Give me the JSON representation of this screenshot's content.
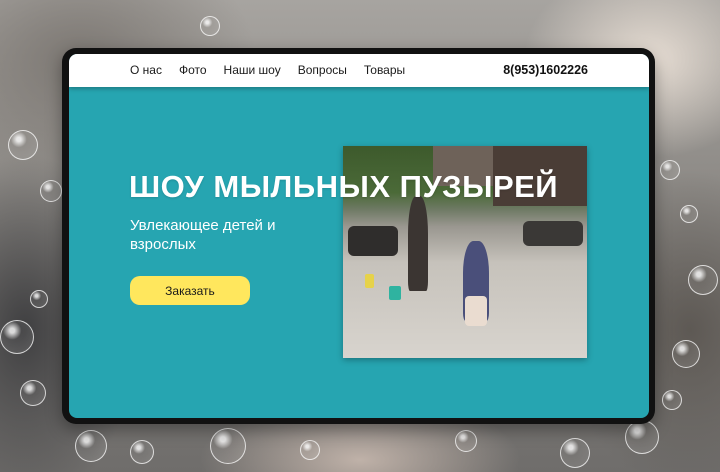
{
  "nav": {
    "items": [
      {
        "label": "О нас"
      },
      {
        "label": "Фото"
      },
      {
        "label": "Наши шоу"
      },
      {
        "label": "Вопросы"
      },
      {
        "label": "Товары"
      }
    ],
    "phone": "8(953)1602226"
  },
  "hero": {
    "title": "ШОУ МЫЛЬНЫХ ПУЗЫРЕЙ",
    "subtitle": "Увлекающее детей и взрослых",
    "order_label": "Заказать"
  },
  "colors": {
    "accent": "#26a5b1",
    "button": "#ffe75d",
    "nav_bg": "#ffffff"
  }
}
